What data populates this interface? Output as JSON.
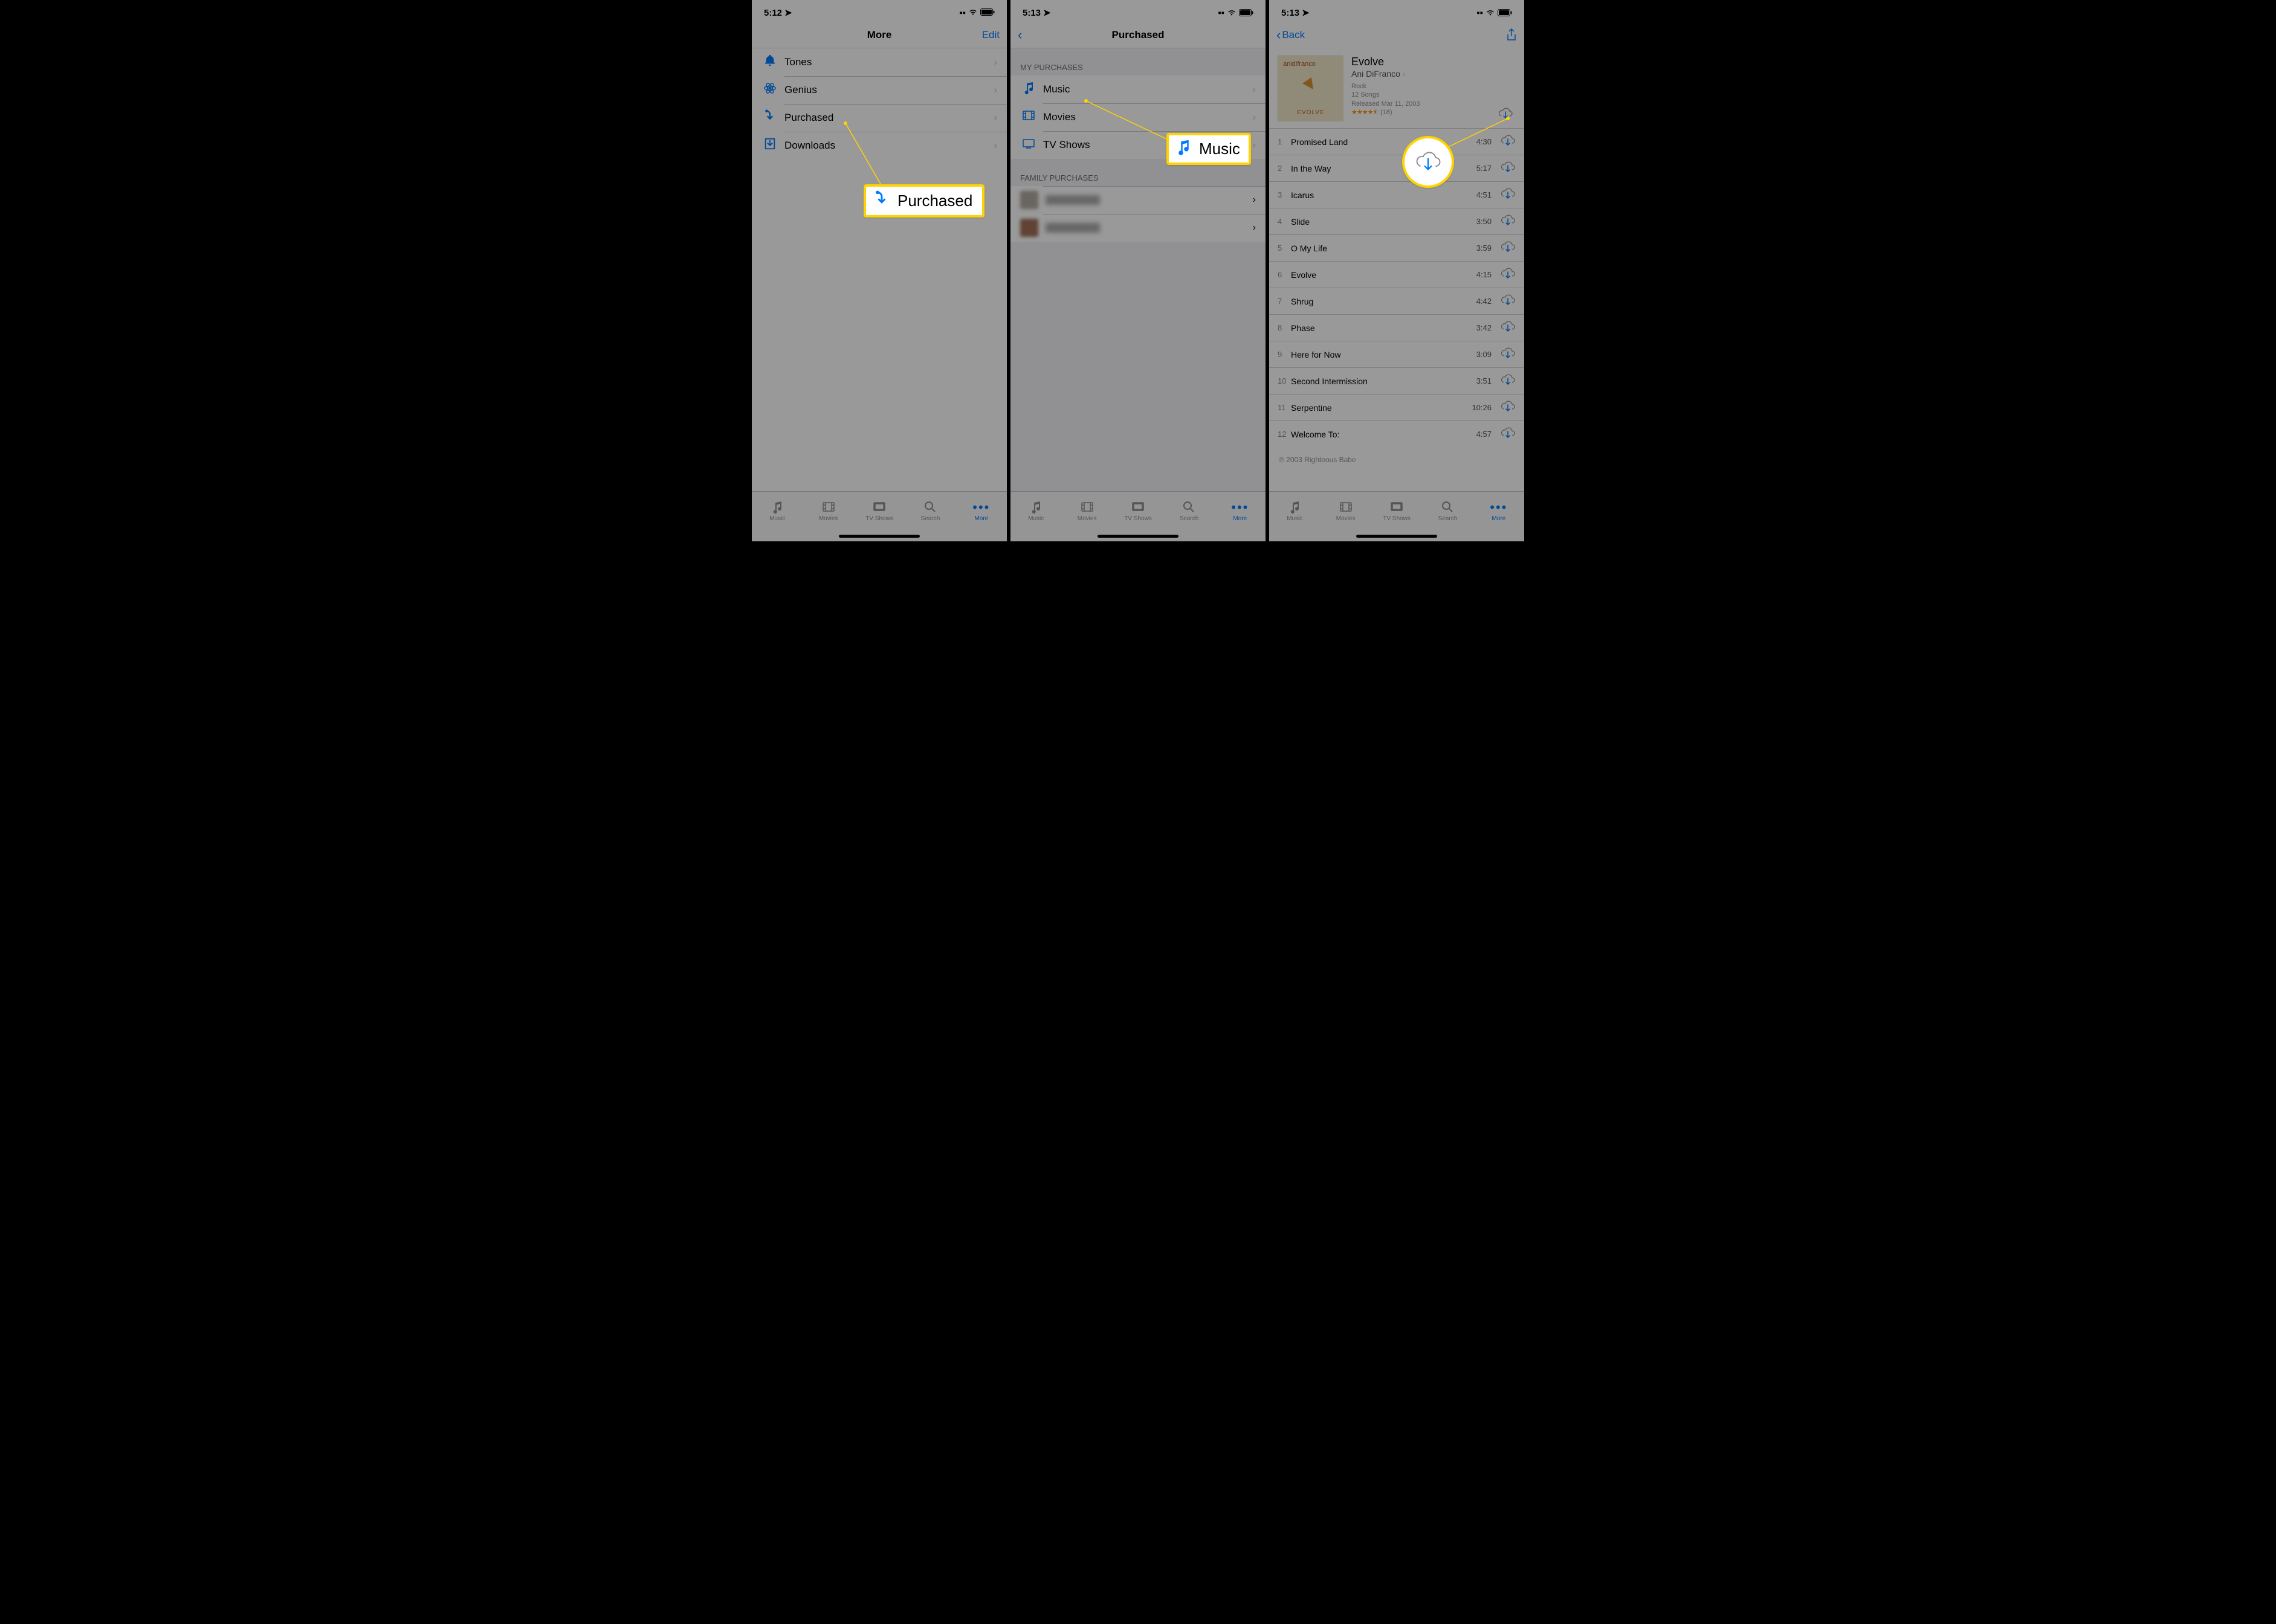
{
  "statusbar": {
    "t1": "5:12",
    "t2": "5:13",
    "t3": "5:13"
  },
  "nav": {
    "more_title": "More",
    "edit": "Edit",
    "purchased_title": "Purchased",
    "back": "Back"
  },
  "more_rows": [
    {
      "icon": "bell",
      "label": "Tones"
    },
    {
      "icon": "atom",
      "label": "Genius"
    },
    {
      "icon": "purchased",
      "label": "Purchased"
    },
    {
      "icon": "download",
      "label": "Downloads"
    }
  ],
  "purchased": {
    "sect_my": "MY PURCHASES",
    "sect_family": "FAMILY PURCHASES",
    "rows": [
      {
        "icon": "music",
        "label": "Music"
      },
      {
        "icon": "movies",
        "label": "Movies"
      },
      {
        "icon": "tv",
        "label": "TV Shows"
      }
    ]
  },
  "album": {
    "title": "Evolve",
    "artist": "Ani DiFranco",
    "genre": "Rock",
    "count": "12 Songs",
    "released": "Released Mar 11, 2003",
    "rating_count": "(18)",
    "copyright": "℗ 2003 Righteous Babe"
  },
  "tracks": [
    {
      "n": "1",
      "name": "Promised Land",
      "dur": "4:30"
    },
    {
      "n": "2",
      "name": "In the Way",
      "dur": "5:17"
    },
    {
      "n": "3",
      "name": "Icarus",
      "dur": "4:51"
    },
    {
      "n": "4",
      "name": "Slide",
      "dur": "3:50"
    },
    {
      "n": "5",
      "name": "O My Life",
      "dur": "3:59"
    },
    {
      "n": "6",
      "name": "Evolve",
      "dur": "4:15"
    },
    {
      "n": "7",
      "name": "Shrug",
      "dur": "4:42"
    },
    {
      "n": "8",
      "name": "Phase",
      "dur": "3:42"
    },
    {
      "n": "9",
      "name": "Here for Now",
      "dur": "3:09"
    },
    {
      "n": "10",
      "name": "Second Intermission",
      "dur": "3:51"
    },
    {
      "n": "11",
      "name": "Serpentine",
      "dur": "10:26"
    },
    {
      "n": "12",
      "name": "Welcome To:",
      "dur": "4:57"
    }
  ],
  "tabs": [
    {
      "label": "Music"
    },
    {
      "label": "Movies"
    },
    {
      "label": "TV Shows"
    },
    {
      "label": "Search"
    },
    {
      "label": "More"
    }
  ],
  "callouts": {
    "purchased": "Purchased",
    "music": "Music"
  }
}
